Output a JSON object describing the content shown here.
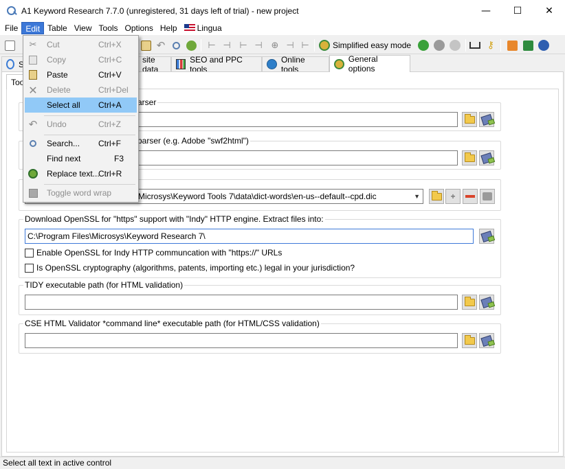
{
  "window": {
    "title": "A1 Keyword Research 7.7.0 (unregistered, 31 days left of trial) - new project",
    "minimize": "—",
    "maximize": "☐",
    "close": "✕"
  },
  "menubar": {
    "items": [
      "File",
      "Edit",
      "Table",
      "View",
      "Tools",
      "Options",
      "Help",
      "Lingua"
    ],
    "active": "Edit"
  },
  "toolbar": {
    "easy_mode_label": "Simplified easy mode"
  },
  "tabs": [
    {
      "label": "S",
      "icon": "magnifier-icon",
      "active": false
    },
    {
      "label": "site data",
      "icon": "site-data-icon",
      "active": false
    },
    {
      "label": "SEO and PPC tools",
      "icon": "chart-icon",
      "active": false
    },
    {
      "label": "Online tools",
      "icon": "globe-icon",
      "active": false
    },
    {
      "label": "General options",
      "icon": "gears-icon",
      "active": true
    }
  ],
  "subtab": {
    "label": "Too"
  },
  "groups": {
    "pdf_parser": {
      "legend": "arser",
      "value": ""
    },
    "swf_parser": {
      "legend": "parser (e.g. Adobe \"swf2html\")",
      "value": ""
    },
    "dictionary": {
      "value": "Microsys\\Keyword Tools 7\\data\\dict-words\\en-us--default--cpd.dic"
    },
    "openssl": {
      "legend": "Download OpenSSL for \"https\" support with \"Indy\" HTTP engine. Extract files into:",
      "value": "C:\\Program Files\\Microsys\\Keyword Research 7\\",
      "check1": "Enable OpenSSL for Indy HTTP communcation with \"https://\" URLs",
      "check2": "Is OpenSSL cryptography (algorithms, patents, importing etc.) legal in your jurisdiction?"
    },
    "tidy": {
      "legend": "TIDY executable path (for HTML validation)",
      "value": ""
    },
    "cse": {
      "legend": "CSE HTML Validator *command line* executable path (for HTML/CSS validation)",
      "value": ""
    }
  },
  "edit_menu": [
    {
      "label": "Cut",
      "shortcut": "Ctrl+X",
      "icon": "scissors-icon",
      "enabled": false
    },
    {
      "label": "Copy",
      "shortcut": "Ctrl+C",
      "icon": "copy-icon",
      "enabled": false
    },
    {
      "label": "Paste",
      "shortcut": "Ctrl+V",
      "icon": "paste-icon",
      "enabled": true
    },
    {
      "label": "Delete",
      "shortcut": "Ctrl+Del",
      "icon": "delete-icon",
      "enabled": false
    },
    {
      "label": "Select all",
      "shortcut": "Ctrl+A",
      "icon": "",
      "enabled": true,
      "highlighted": true
    },
    {
      "label": "Undo",
      "shortcut": "Ctrl+Z",
      "icon": "undo-icon",
      "enabled": false
    },
    {
      "label": "Search...",
      "shortcut": "Ctrl+F",
      "icon": "search-icon",
      "enabled": true
    },
    {
      "label": "Find next",
      "shortcut": "F3",
      "icon": "",
      "enabled": true
    },
    {
      "label": "Replace text...",
      "shortcut": "Ctrl+R",
      "icon": "replace-icon",
      "enabled": true
    },
    {
      "label": "Toggle word wrap",
      "shortcut": "",
      "icon": "word-wrap-icon",
      "enabled": false
    }
  ],
  "statusbar": {
    "text": "Select all text in active control"
  },
  "colors": {
    "menu_highlight": "#91c9f7",
    "active_menu": "#3c78d8"
  }
}
